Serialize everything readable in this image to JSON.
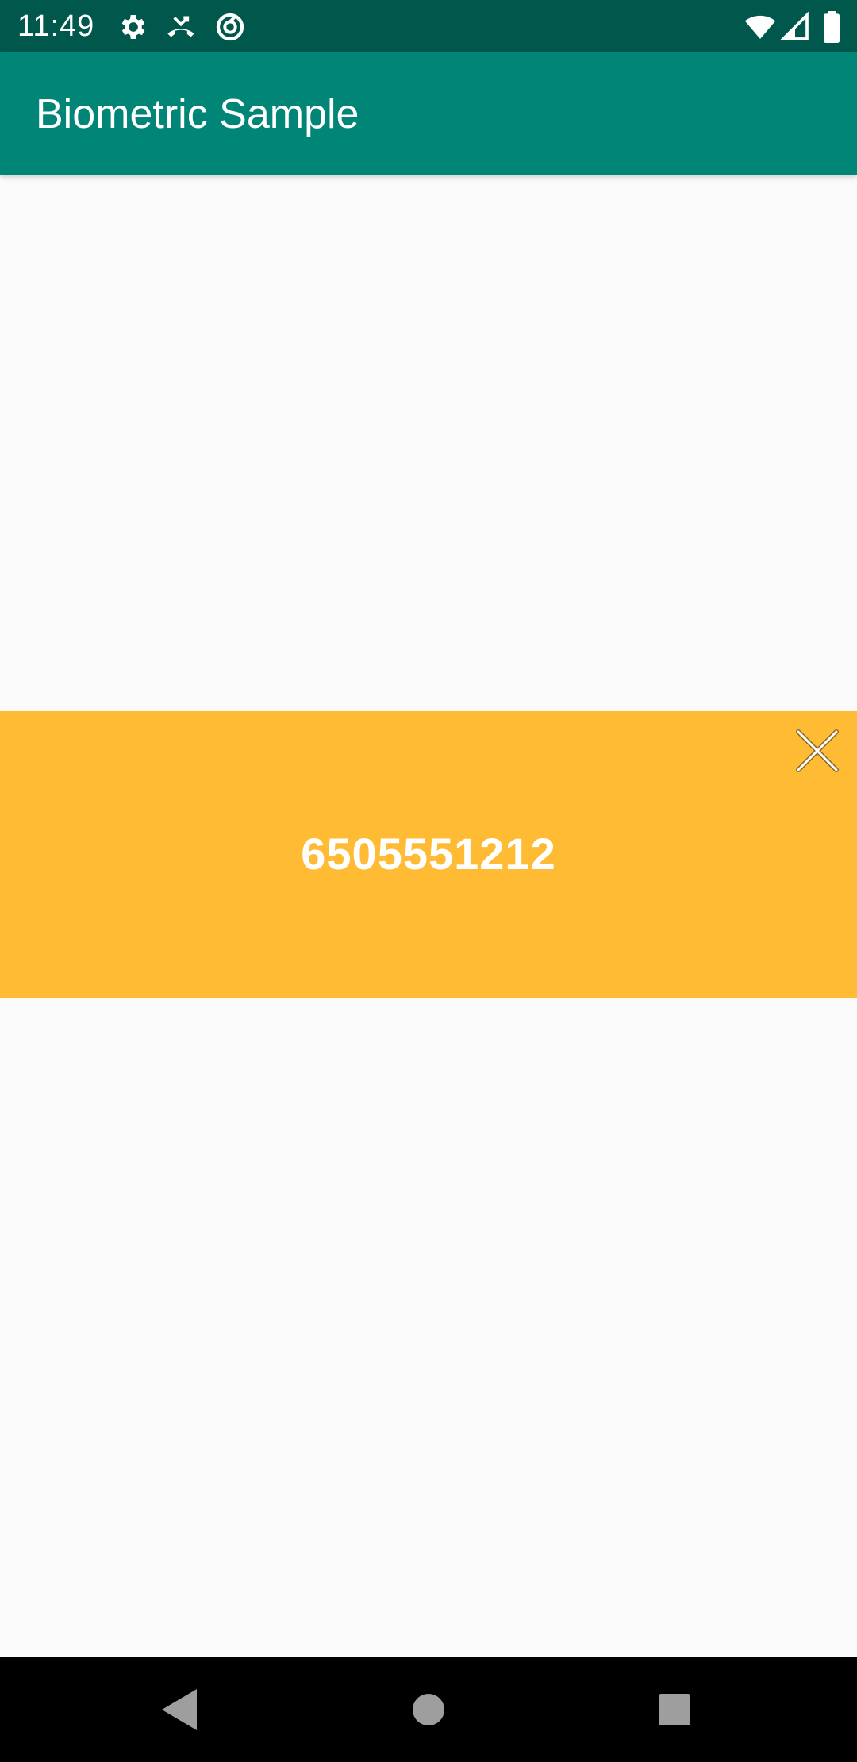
{
  "status_bar": {
    "time": "11:49",
    "left_icons": [
      "settings-icon",
      "missed-call-icon",
      "data-saver-icon"
    ],
    "right_icons": [
      "wifi-icon",
      "cell-signal-icon",
      "battery-icon"
    ],
    "background_color": "#00574b"
  },
  "app_bar": {
    "title": "Biometric Sample",
    "background_color": "#008577"
  },
  "banner": {
    "value": "6505551212",
    "background_color": "#ffbb33",
    "close_icon": "close-icon"
  },
  "nav_bar": {
    "buttons": [
      "back-icon",
      "home-icon",
      "recents-icon"
    ]
  }
}
